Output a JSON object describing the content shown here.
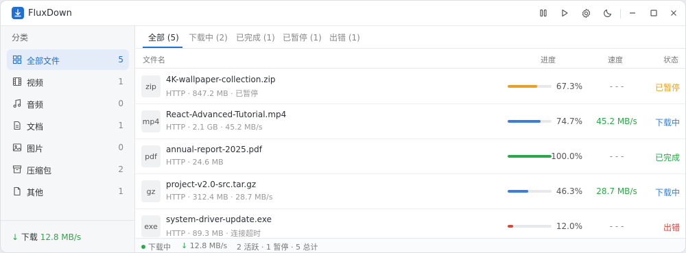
{
  "app": {
    "name_prefix": "Flux",
    "name_suffix": "Down"
  },
  "titlebar": {
    "buttons": [
      "pause-all",
      "start-all",
      "settings",
      "theme",
      "minimize",
      "maximize",
      "close"
    ]
  },
  "sidebar": {
    "heading": "分类",
    "items": [
      {
        "label": "全部文件",
        "count": "5",
        "icon": "grid-icon",
        "active": true
      },
      {
        "label": "视频",
        "count": "1",
        "icon": "film-icon",
        "active": false
      },
      {
        "label": "音频",
        "count": "0",
        "icon": "music-icon",
        "active": false
      },
      {
        "label": "文档",
        "count": "1",
        "icon": "document-icon",
        "active": false
      },
      {
        "label": "图片",
        "count": "0",
        "icon": "image-icon",
        "active": false
      },
      {
        "label": "压缩包",
        "count": "2",
        "icon": "archive-icon",
        "active": false
      },
      {
        "label": "其他",
        "count": "1",
        "icon": "file-icon",
        "active": false
      }
    ],
    "speed_label": "下载",
    "speed_value": "12.8 MB/s"
  },
  "tabs": [
    {
      "label": "全部 (5)",
      "active": true
    },
    {
      "label": "下载中 (2)",
      "active": false
    },
    {
      "label": "已完成 (1)",
      "active": false
    },
    {
      "label": "已暂停 (1)",
      "active": false
    },
    {
      "label": "出错 (1)",
      "active": false
    }
  ],
  "columns": {
    "name": "文件名",
    "progress": "进度",
    "speed": "速度",
    "status": "状态"
  },
  "files": [
    {
      "ext": "zip",
      "name": "4K-wallpaper-collection.zip",
      "meta": "HTTP · 847.2 MB · 已暂停",
      "progress": 0.673,
      "progress_text": "67.3%",
      "bar_color": "#e8a126",
      "speed": "- - -",
      "speed_color": "#888888",
      "status": "已暂停",
      "status_color": "#e8a126"
    },
    {
      "ext": "mp4",
      "name": "React-Advanced-Tutorial.mp4",
      "meta": "HTTP · 2.1 GB · 45.2 MB/s",
      "progress": 0.747,
      "progress_text": "74.7%",
      "bar_color": "#3b7ddd",
      "speed": "45.2 MB/s",
      "speed_color": "#2aa84a",
      "status": "下载中",
      "status_color": "#2f7de1"
    },
    {
      "ext": "pdf",
      "name": "annual-report-2025.pdf",
      "meta": "HTTP · 24.6 MB",
      "progress": 1.0,
      "progress_text": "100.0%",
      "bar_color": "#2aa84a",
      "speed": "- - -",
      "speed_color": "#888888",
      "status": "已完成",
      "status_color": "#2aa84a"
    },
    {
      "ext": "gz",
      "name": "project-v2.0-src.tar.gz",
      "meta": "HTTP · 312.4 MB · 28.7 MB/s",
      "progress": 0.463,
      "progress_text": "46.3%",
      "bar_color": "#3b7ddd",
      "speed": "28.7 MB/s",
      "speed_color": "#2aa84a",
      "status": "下载中",
      "status_color": "#2f7de1"
    },
    {
      "ext": "exe",
      "name": "system-driver-update.exe",
      "meta": "HTTP · 89.3 MB · 连接超时",
      "progress": 0.12,
      "progress_text": "12.0%",
      "bar_color": "#d9453b",
      "speed": "- - -",
      "speed_color": "#888888",
      "status": "出错",
      "status_color": "#d9453b"
    }
  ],
  "footer": {
    "state": "下载中",
    "speed": "12.8 MB/s",
    "summary": "2 活跃 · 1 暂停 · 5 总计"
  }
}
